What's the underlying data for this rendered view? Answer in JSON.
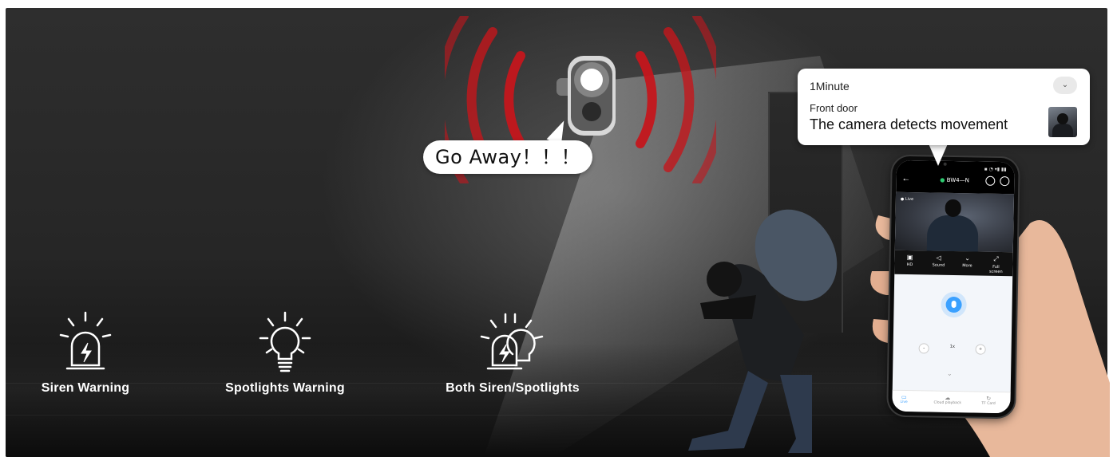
{
  "speech_bubble": {
    "text": "Go Away！！！"
  },
  "features": [
    {
      "label": "Siren Warning",
      "icon": "siren-icon"
    },
    {
      "label": "Spotlights Warning",
      "icon": "lightbulb-icon"
    },
    {
      "label": "Both Siren/Spotlights",
      "icon": "siren-spotlight-icon"
    }
  ],
  "notification": {
    "time": "1Minute",
    "source": "Front door",
    "message": "The camera detects movement",
    "expand_icon": "chevron-down-icon"
  },
  "phone_app": {
    "device_name": "BW4—N",
    "live_badge": "Live",
    "controls": [
      {
        "label": "HD",
        "icon": "hd-icon"
      },
      {
        "label": "Sound",
        "icon": "speaker-icon"
      },
      {
        "label": "More",
        "icon": "chevron-double-down-icon"
      },
      {
        "label": "Full screen",
        "icon": "fullscreen-icon"
      }
    ],
    "zoom": {
      "minus": "-",
      "value": "1x",
      "plus": "+"
    },
    "tabs": [
      {
        "label": "Live",
        "icon": "live-icon",
        "active": true
      },
      {
        "label": "Cloud playback",
        "icon": "cloud-icon",
        "active": false
      },
      {
        "label": "TF Card",
        "icon": "sdcard-icon",
        "active": false
      }
    ]
  },
  "colors": {
    "siren_red": "#c4161c",
    "background_dark": "#2b2b2b",
    "app_accent": "#3aa0ff"
  }
}
